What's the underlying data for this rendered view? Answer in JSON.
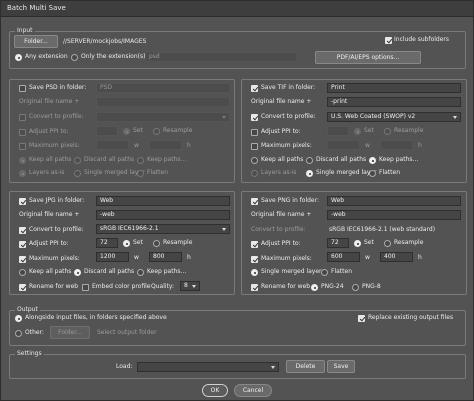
{
  "window": {
    "title": "Batch Multi Save"
  },
  "input": {
    "group_label": "Input",
    "folder_button": "Folder...",
    "folder_path": "//SERVER/mockjobs/IMAGES",
    "include_subfolders": "Include subfolders",
    "any_extension": "Any extension",
    "only_extensions": "Only the extension(s):",
    "extension_value": "psd",
    "pdf_options": "PDF/AI/EPS options..."
  },
  "psd": {
    "save_label": "Save PSD in folder:",
    "folder": "PSD",
    "filename_label": "Original file name +",
    "filename_value": "",
    "convert_label": "Convert to profile:",
    "profile": "",
    "ppi_label": "Adjust PPI to:",
    "ppi": "",
    "set": "Set",
    "resample": "Resample",
    "max_label": "Maximum pixels:",
    "w": "w",
    "h": "h",
    "keep_all_paths": "Keep all paths",
    "discard_all_paths": "Discard all paths",
    "keep_paths": "Keep paths...",
    "layers_asis": "Layers as-is",
    "single_merged": "Single merged layer",
    "flatten": "Flatten"
  },
  "tif": {
    "save_label": "Save TIF in folder:",
    "folder": "Print",
    "filename_label": "Original file name +",
    "filename_value": "-print",
    "convert_label": "Convert to profile:",
    "profile": "U.S. Web Coated (SWOP) v2",
    "ppi_label": "Adjust PPI to:",
    "ppi": "",
    "set": "Set",
    "resample": "Resample",
    "max_label": "Maximum pixels:",
    "w": "w",
    "h": "h",
    "keep_all_paths": "Keep all paths",
    "discard_all_paths": "Discard all paths",
    "keep_paths": "Keep paths...",
    "layers_asis": "Layers as-is",
    "single_merged": "Single merged layer",
    "flatten": "Flatten"
  },
  "jpg": {
    "save_label": "Save JPG in folder:",
    "folder": "Web",
    "filename_label": "Original file name +",
    "filename_value": "-web",
    "convert_label": "Convert to profile:",
    "profile": "sRGB IEC61966-2.1",
    "ppi_label": "Adjust PPI to:",
    "ppi": "72",
    "set": "Set",
    "resample": "Resample",
    "max_label": "Maximum pixels:",
    "max_w": "1200",
    "w": "w",
    "max_h": "800",
    "h": "h",
    "keep_all_paths": "Keep all paths",
    "discard_all_paths": "Discard all paths",
    "keep_paths": "Keep paths...",
    "rename_web": "Rename for web",
    "embed_color": "Embed color profile",
    "quality_label": "Quality:",
    "quality": "8"
  },
  "png": {
    "save_label": "Save PNG in folder:",
    "folder": "Web",
    "filename_label": "Original file name +",
    "filename_value": "-web",
    "convert_label": "Convert to profile:",
    "profile": "sRGB IEC61966-2.1 (web standard)",
    "ppi_label": "Adjust PPI to:",
    "ppi": "72",
    "set": "Set",
    "resample": "Resample",
    "max_label": "Maximum pixels:",
    "max_w": "600",
    "w": "w",
    "max_h": "400",
    "h": "h",
    "keep_all_paths": "Keep all paths",
    "discard_all_paths": "Discard all paths",
    "keep_paths": "Keep paths...",
    "single_merged": "Single merged layer",
    "flatten": "Flatten",
    "rename_web": "Rename for web",
    "png24": "PNG-24",
    "png8": "PNG-8"
  },
  "output": {
    "group_label": "Output",
    "alongside": "Alongside input files, in folders specified above",
    "replace": "Replace existing output files",
    "other": "Other:",
    "folder_button": "Folder...",
    "select_folder": "Select output folder"
  },
  "settings": {
    "group_label": "Settings",
    "load_label": "Load:",
    "load_value": "",
    "delete_button": "Delete",
    "save_button": "Save"
  },
  "footer": {
    "ok": "OK",
    "cancel": "Cancel"
  }
}
